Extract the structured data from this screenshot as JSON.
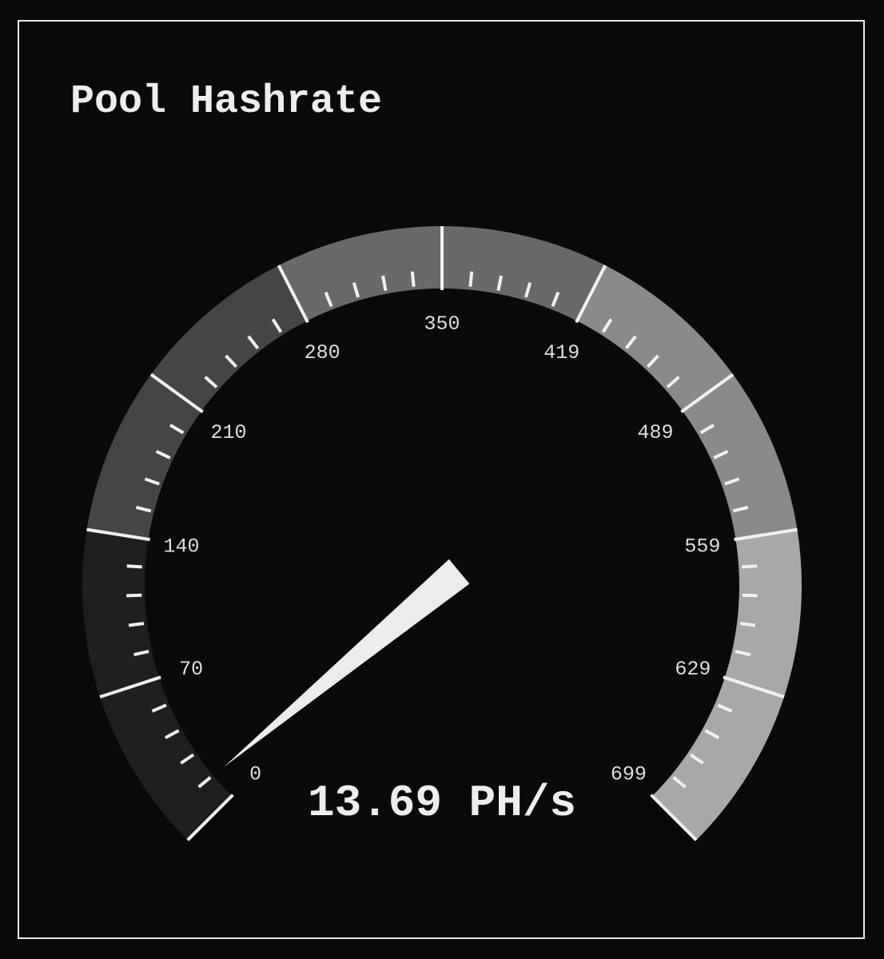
{
  "panel": {
    "title": "Pool Hashrate"
  },
  "gauge": {
    "min": 0,
    "max": 699,
    "value": 13.69,
    "unit": "PH/s",
    "readout": "13.69 PH/s",
    "tick_labels": [
      "0",
      "70",
      "140",
      "210",
      "280",
      "350",
      "419",
      "489",
      "559",
      "629",
      "699"
    ],
    "minor_ticks_per_segment": 4,
    "band_colors": [
      "#1f1f1f",
      "#1f1f1f",
      "#454545",
      "#454545",
      "#696969",
      "#696969",
      "#8a8a8a",
      "#8a8a8a",
      "#a8a8a8",
      "#a8a8a8"
    ],
    "colors": {
      "background": "#0a0a0a",
      "border": "#e8e8e8",
      "ticks": "#f0f0f0",
      "needle": "#ececec",
      "text": "#ededed"
    }
  }
}
